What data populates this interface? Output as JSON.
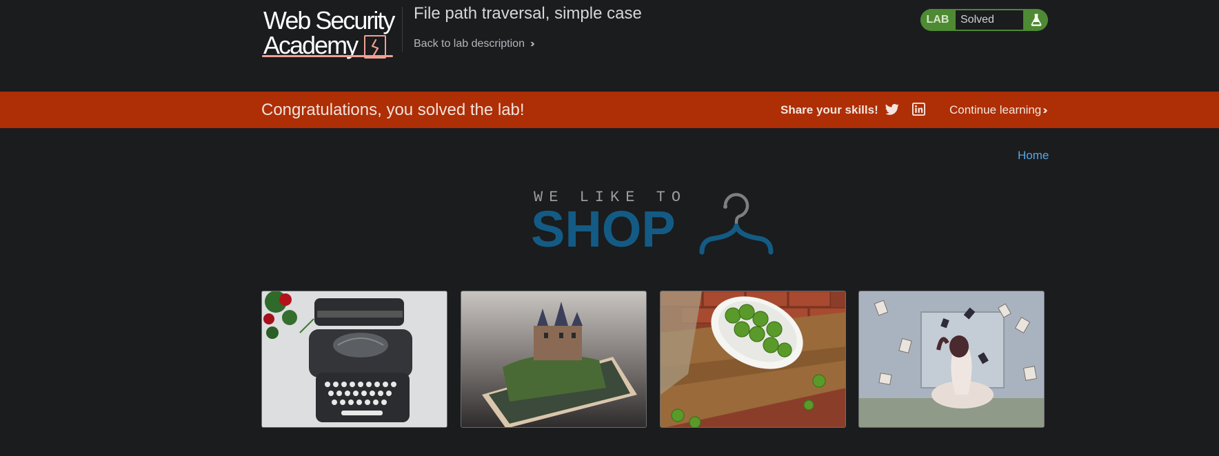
{
  "header": {
    "logo_line1": "Web Security",
    "logo_line2": "Academy",
    "lab_title": "File path traversal, simple case",
    "back_link": "Back to lab description",
    "lab_status": {
      "label": "LAB",
      "value": "Solved",
      "accent": "#4e8a33"
    }
  },
  "banner": {
    "message": "Congratulations, you solved the lab!",
    "share_label": "Share your skills!",
    "continue_label": "Continue learning",
    "background": "#ae2e05"
  },
  "nav": {
    "home_label": "Home"
  },
  "shop_logo": {
    "small_text": "WE LIKE TO",
    "big_text": "SHOP",
    "accent": "#135b84"
  },
  "products": [
    {
      "image": "typewriter-with-roses"
    },
    {
      "image": "castle-on-smartphone"
    },
    {
      "image": "brussels-sprouts-bowl"
    },
    {
      "image": "woman-with-flying-books"
    }
  ],
  "icons": {
    "twitter": "twitter-icon",
    "linkedin": "linkedin-icon",
    "flask": "flask-icon",
    "hanger": "hanger-icon"
  }
}
